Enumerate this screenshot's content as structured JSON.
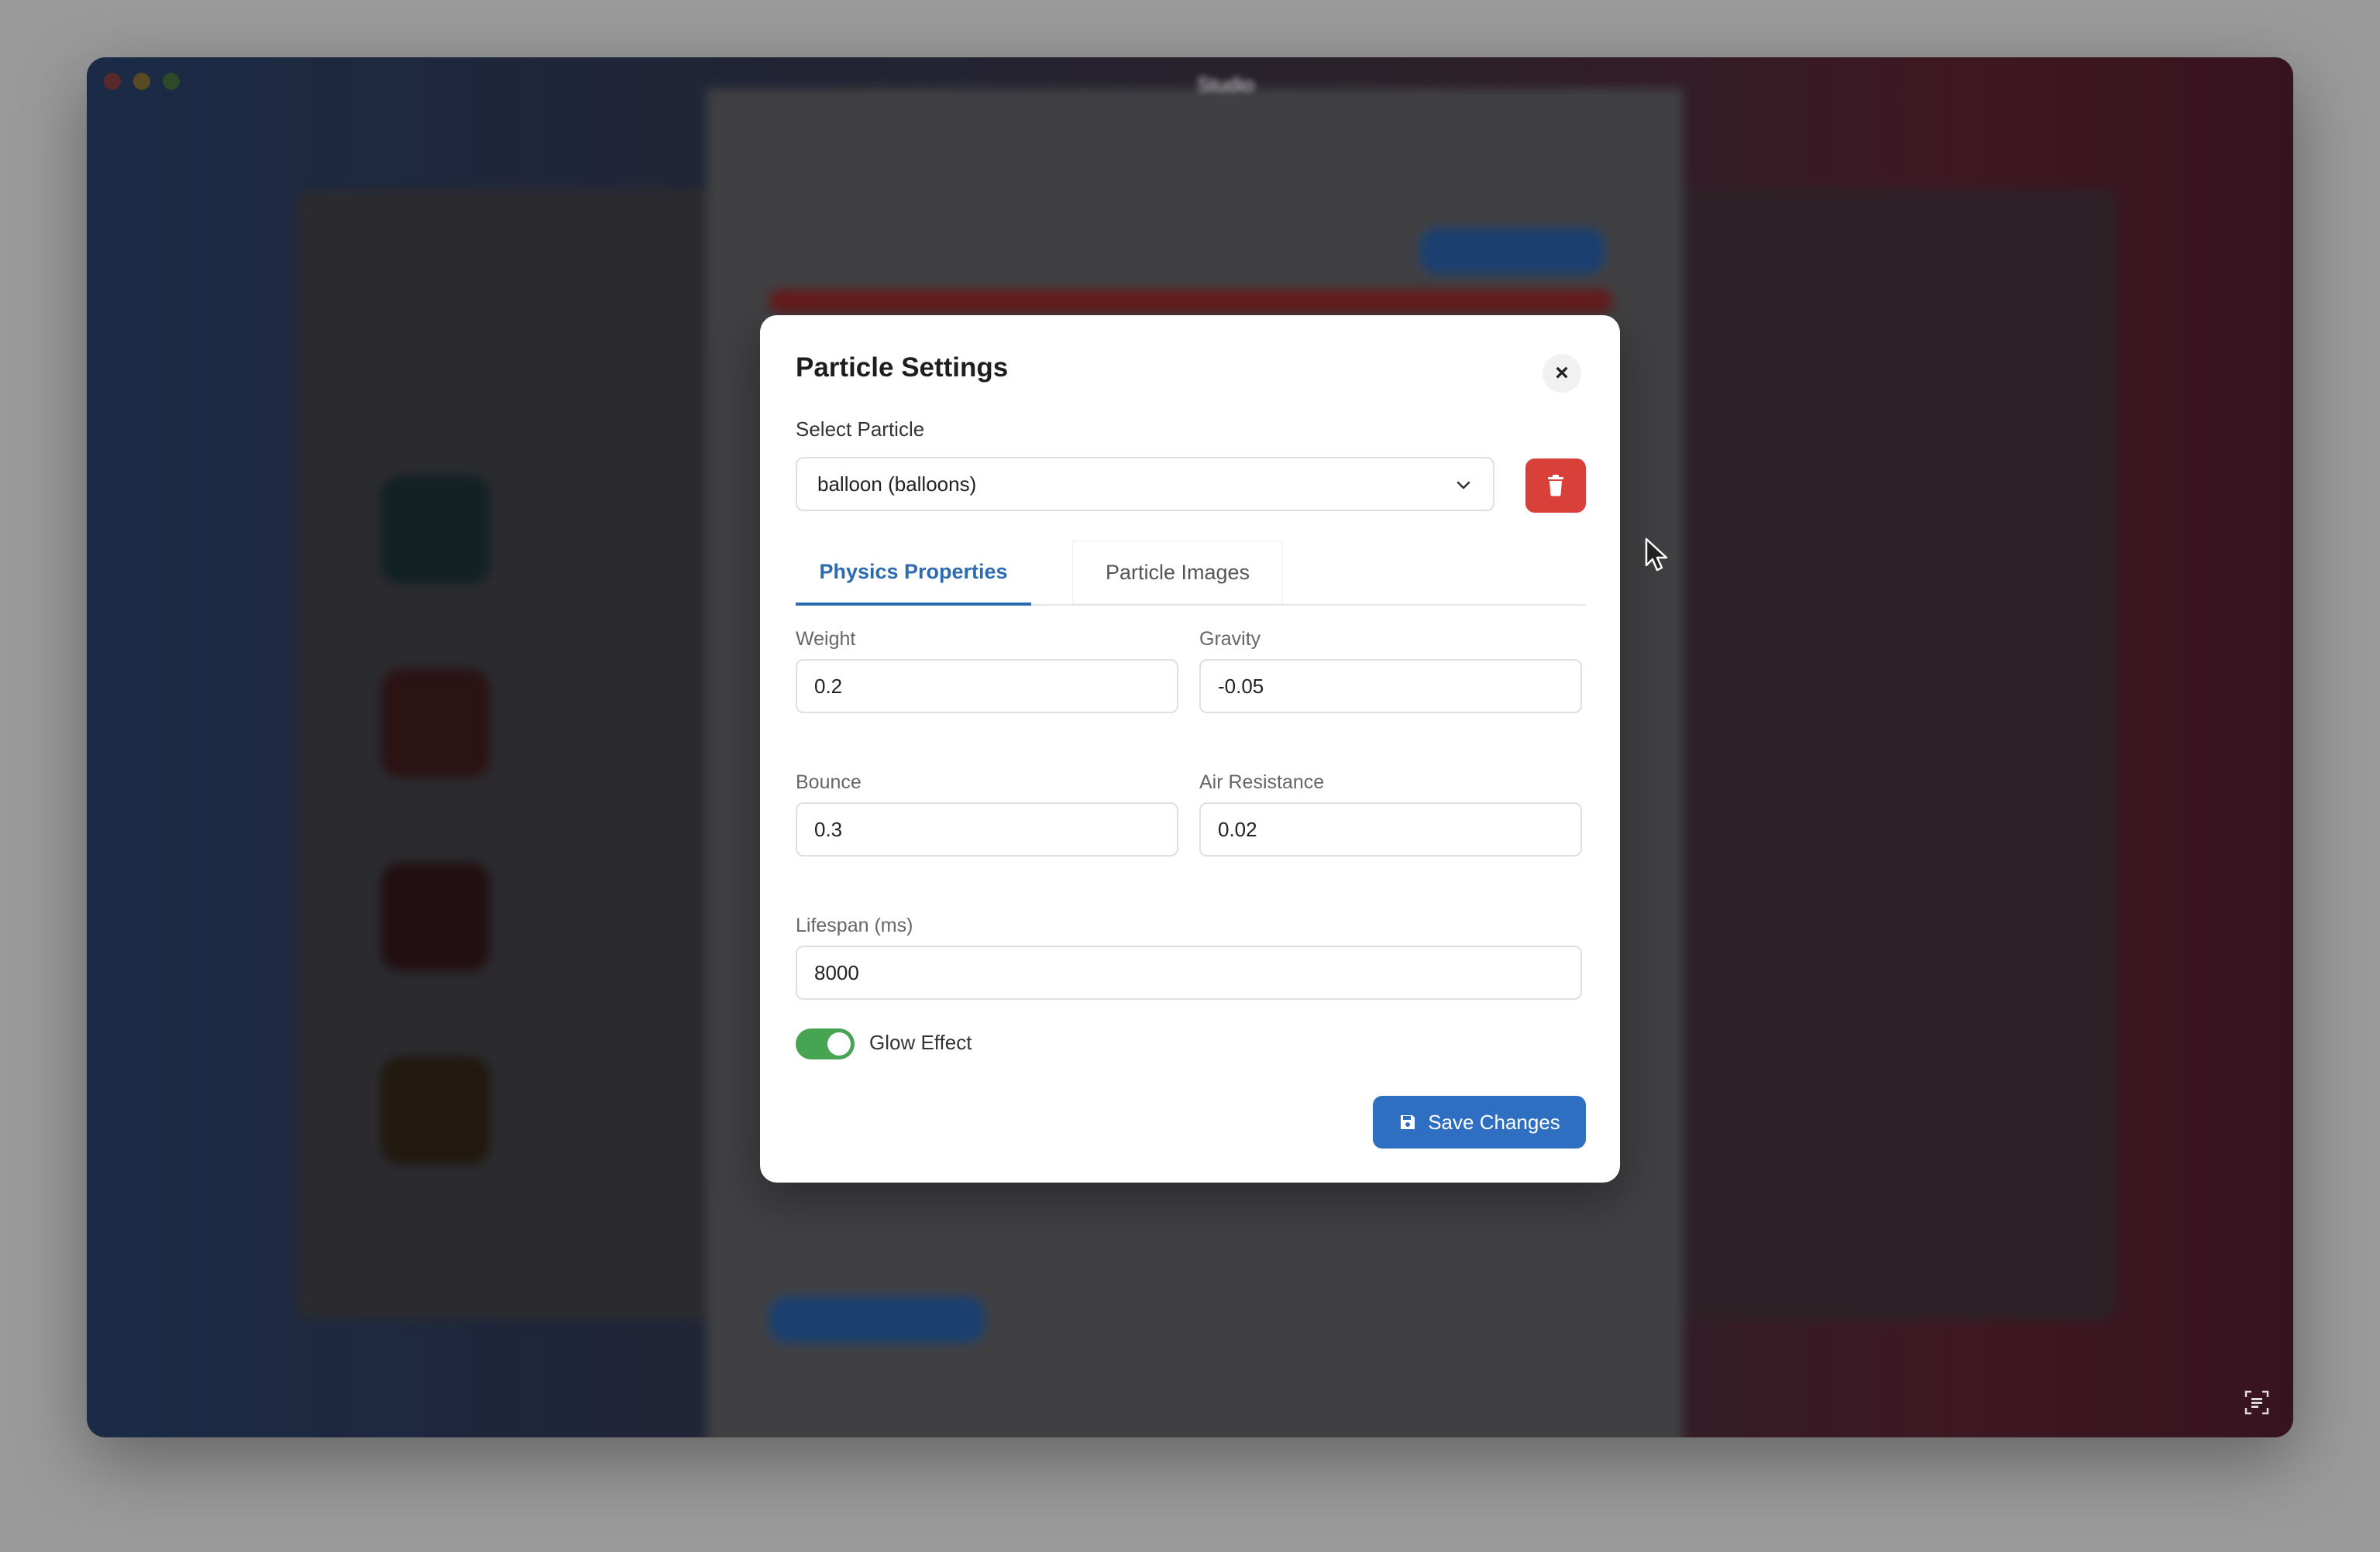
{
  "window": {
    "title": "Studio"
  },
  "modal": {
    "title": "Particle Settings",
    "close_label": "×",
    "select": {
      "label": "Select Particle",
      "value": "balloon (balloons)"
    },
    "tabs": [
      {
        "label": "Physics Properties",
        "active": true
      },
      {
        "label": "Particle Images",
        "active": false
      }
    ],
    "fields": {
      "weight": {
        "label": "Weight",
        "value": "0.2"
      },
      "gravity": {
        "label": "Gravity",
        "value": "-0.05"
      },
      "bounce": {
        "label": "Bounce",
        "value": "0.3"
      },
      "air_resistance": {
        "label": "Air Resistance",
        "value": "0.02"
      },
      "lifespan": {
        "label": "Lifespan (ms)",
        "value": "8000"
      }
    },
    "glow": {
      "label": "Glow Effect",
      "enabled": true
    },
    "save_label": "Save Changes"
  },
  "colors": {
    "accent": "#2f6fc2",
    "danger": "#d9403a",
    "toggle_on": "#45a552"
  },
  "icons": [
    "close-icon",
    "chevron-down-icon",
    "trash-icon",
    "save-icon",
    "cursor-icon",
    "screenshot-icon"
  ]
}
